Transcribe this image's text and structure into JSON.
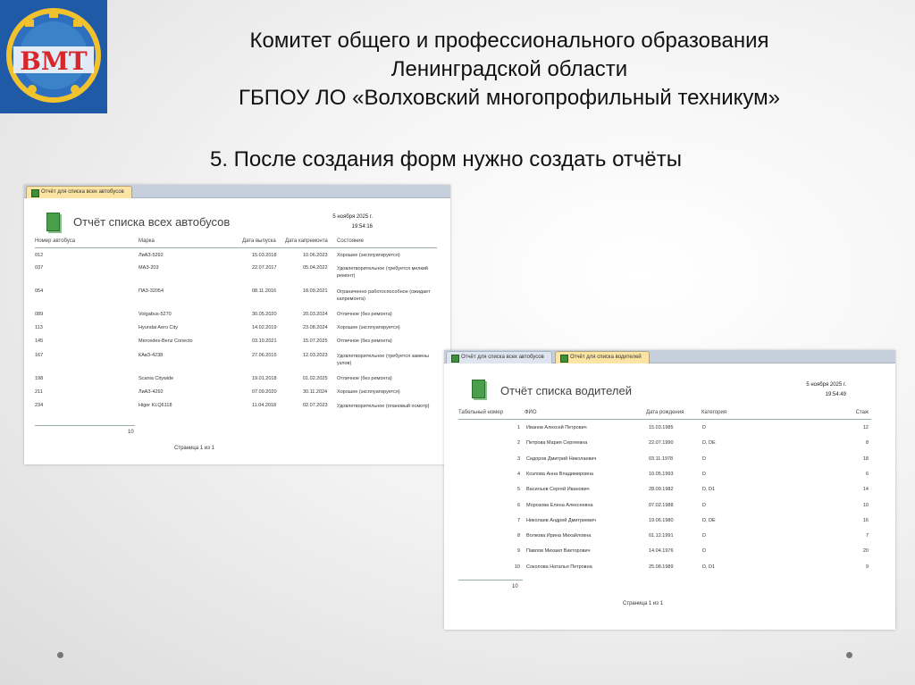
{
  "slide": {
    "header_lines": [
      "Комитет общего и профессионального образования",
      "Ленинградской области",
      "ГБПОУ ЛО  «Волховский многопрофильный техникум»"
    ],
    "subtitle": "5. После создания форм нужно создать отчёты",
    "logo_text": "ВМТ"
  },
  "report_buses": {
    "tab_label": "Отчёт для списка всех автобусов",
    "title": "Отчёт списка всех автобусов",
    "date": "5 ноября 2025 г.",
    "time": "19:54:16",
    "columns": [
      "Номер автобуса",
      "Марка",
      "Дата выпуска",
      "Дата капремонта",
      "Состояние"
    ],
    "rows": [
      {
        "num": "012",
        "brand": "ЛиАЗ-5292",
        "released": "15.03.2018",
        "repair": "10.06.2023",
        "state": "Хорошее (эксплуатируется)"
      },
      {
        "num": "037",
        "brand": "МАЗ-203",
        "released": "22.07.2017",
        "repair": "05.04.2022",
        "state": "Удовлетворительное (требуется мелкий ремонт)"
      },
      {
        "num": "054",
        "brand": "ПАЗ-32054",
        "released": "08.11.2016",
        "repair": "18.09.2021",
        "state": "Ограниченно работоспособное (ожидает капремонта)"
      },
      {
        "num": "089",
        "brand": "Volgabus-5270",
        "released": "30.05.2020",
        "repair": "20.03.2024",
        "state": "Отличное (без ремонта)"
      },
      {
        "num": "113",
        "brand": "Hyundai Aero City",
        "released": "14.02.2019",
        "repair": "23.08.2024",
        "state": "Хорошее (эксплуатируется)"
      },
      {
        "num": "145",
        "brand": "Mercedes-Benz Conecto",
        "released": "03.10.2021",
        "repair": "15.07.2025",
        "state": "Отличное (без ремонта)"
      },
      {
        "num": "167",
        "brand": "КАвЗ-4238",
        "released": "27.06.2015",
        "repair": "12.03.2023",
        "state": "Удовлетворительное (требуется замены узлов)"
      },
      {
        "num": "198",
        "brand": "Scania Citywide",
        "released": "19.01.2018",
        "repair": "01.02.2025",
        "state": "Отличное (без ремонта)"
      },
      {
        "num": "211",
        "brand": "ЛиАЗ-4292",
        "released": "07.09.2020",
        "repair": "30.11.2024",
        "state": "Хорошее (эксплуатируется)"
      },
      {
        "num": "234",
        "brand": "Higer KLQ6118",
        "released": "11.04.2018",
        "repair": "02.07.2023",
        "state": "Удовлетворительное (плановый осмотр)"
      }
    ],
    "count": "10",
    "page": "Страница 1 из 1"
  },
  "report_drivers": {
    "tab_inactive": "Отчёт для списка всех автобусов",
    "tab_label": "Отчёт для списка водителей",
    "title": "Отчёт списка водителей",
    "date": "5 ноября 2025 г.",
    "time": "19:54:49",
    "columns": [
      "Табельный номер",
      "ФИО",
      "Дата рождения",
      "Категория",
      "Стаж"
    ],
    "rows": [
      {
        "id": "1",
        "name": "Иванов Алексей Петрович",
        "born": "15.03.1985",
        "cat": "D",
        "exp": "12"
      },
      {
        "id": "2",
        "name": "Петрова Мария Сергеевна",
        "born": "22.07.1990",
        "cat": "D, DE",
        "exp": "8"
      },
      {
        "id": "3",
        "name": "Сидоров Дмитрий Николаевич",
        "born": "03.11.1978",
        "cat": "D",
        "exp": "18"
      },
      {
        "id": "4",
        "name": "Козлова Анна Владимировна",
        "born": "10.05.1993",
        "cat": "D",
        "exp": "6"
      },
      {
        "id": "5",
        "name": "Васильев Сергей Иванович",
        "born": "28.09.1982",
        "cat": "D, D1",
        "exp": "14"
      },
      {
        "id": "6",
        "name": "Морозова Елена Алексеевна",
        "born": "07.02.1988",
        "cat": "D",
        "exp": "10"
      },
      {
        "id": "7",
        "name": "Николаев Андрей Дмитриевич",
        "born": "19.06.1980",
        "cat": "D, DE",
        "exp": "16"
      },
      {
        "id": "8",
        "name": "Волкова Ирина Михайловна",
        "born": "01.12.1991",
        "cat": "D",
        "exp": "7"
      },
      {
        "id": "9",
        "name": "Павлов Михаил Викторович",
        "born": "14.04.1976",
        "cat": "D",
        "exp": "20"
      },
      {
        "id": "10",
        "name": "Соколова Наталья Петровна",
        "born": "25.08.1989",
        "cat": "D, D1",
        "exp": "9"
      }
    ],
    "count": "10",
    "page": "Страница 1 из 1"
  },
  "colors": {
    "logo_bg": "#1f5aa6",
    "logo_text": "#d8262d",
    "tab_active": "#fbe4a4",
    "tabbar": "#c6cfdc",
    "report_icon": "#4aa04a"
  }
}
